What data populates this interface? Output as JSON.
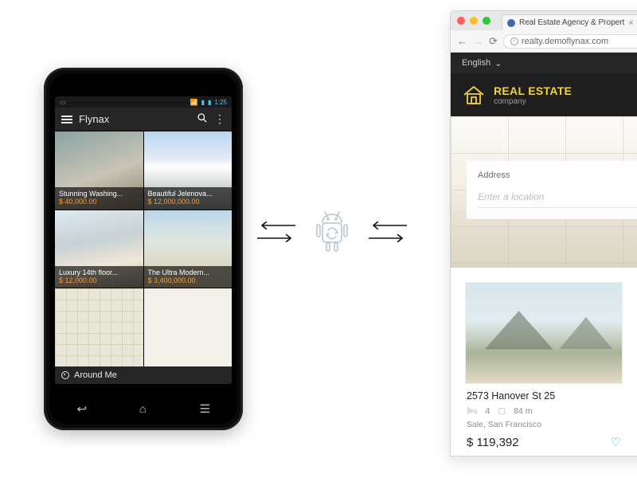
{
  "phone": {
    "statusbar": {
      "time": "1:25"
    },
    "appbar": {
      "title": "Flynax",
      "search_label": "Search",
      "overflow_label": "More"
    },
    "tiles": [
      {
        "title": "Stunning Washing...",
        "price": "$ 40,000.00"
      },
      {
        "title": "Beautiful Jelenova...",
        "price": "$ 12,000,000.00"
      },
      {
        "title": "Luxury 14th floor...",
        "price": "$ 12,000.00"
      },
      {
        "title": "The Ultra Modern...",
        "price": "$ 3,400,000.00"
      }
    ],
    "around_label": "Around Me",
    "nav": {
      "back": "Back",
      "home": "Home",
      "recent": "Recent"
    }
  },
  "browser": {
    "window_buttons": {
      "close": "Close",
      "min": "Minimize",
      "max": "Maximize"
    },
    "tab_title": "Real Estate Agency & Propert",
    "tab_close": "Close tab",
    "nav": {
      "back": "Back",
      "forward": "Forward",
      "reload": "Reload"
    },
    "url": "realty.demoflynax.com",
    "language": "English",
    "brand": {
      "name": "REAL ESTATE",
      "tag": "company"
    },
    "search": {
      "label": "Address",
      "placeholder": "Enter a location"
    },
    "listing": {
      "address": "2573 Hanover St 25",
      "beds": "4",
      "area": "84 m",
      "sale_line": "Sale, San Francisco",
      "price": "$ 119,392",
      "favorite_label": "Favorite"
    }
  },
  "sync_alt": "Sync between Android app and website"
}
